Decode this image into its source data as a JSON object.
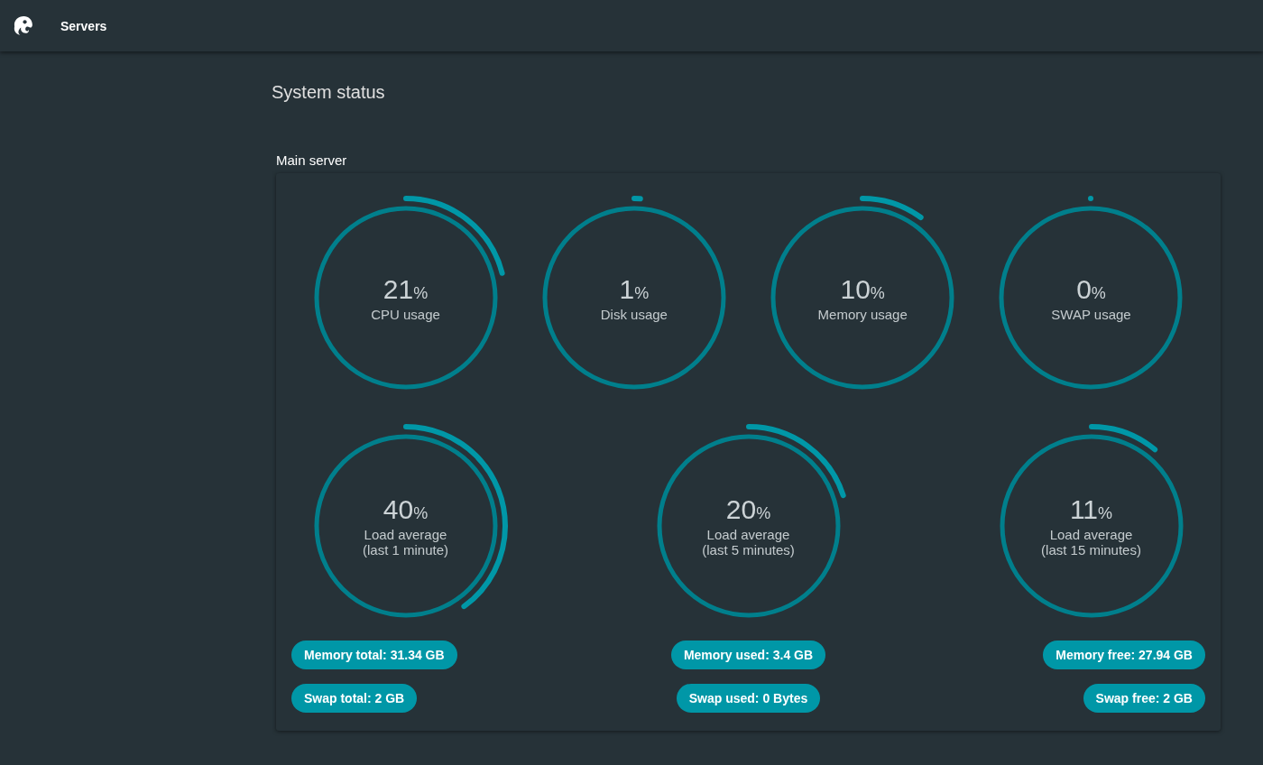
{
  "header": {
    "title": "Servers"
  },
  "page_title": "System status",
  "server": {
    "name": "Main server",
    "gauge_rows": [
      [
        {
          "value": "21",
          "unit": "%",
          "label": "CPU usage",
          "level": 0.21
        },
        {
          "value": "1",
          "unit": "%",
          "label": "Disk usage",
          "level": 0.01
        },
        {
          "value": "10",
          "unit": "%",
          "label": "Memory usage",
          "level": 0.1
        },
        {
          "value": "0",
          "unit": "%",
          "label": "SWAP usage",
          "level": 0
        }
      ],
      [
        {
          "value": "40",
          "unit": "%",
          "label": "Load average\n(last 1 minute)",
          "level": 0.4
        },
        {
          "value": "20",
          "unit": "%",
          "label": "Load average\n(last 5 minutes)",
          "level": 0.2
        },
        {
          "value": "11",
          "unit": "%",
          "label": "Load average\n(last 15 minutes)",
          "level": 0.11
        }
      ]
    ],
    "stat_rows": [
      [
        "Memory total: 31.34 GB",
        "Memory used: 3.4 GB",
        "Memory free: 27.94 GB"
      ],
      [
        "Swap total: 2 GB",
        "Swap used: 0 Bytes",
        "Swap free: 2 GB"
      ]
    ]
  }
}
